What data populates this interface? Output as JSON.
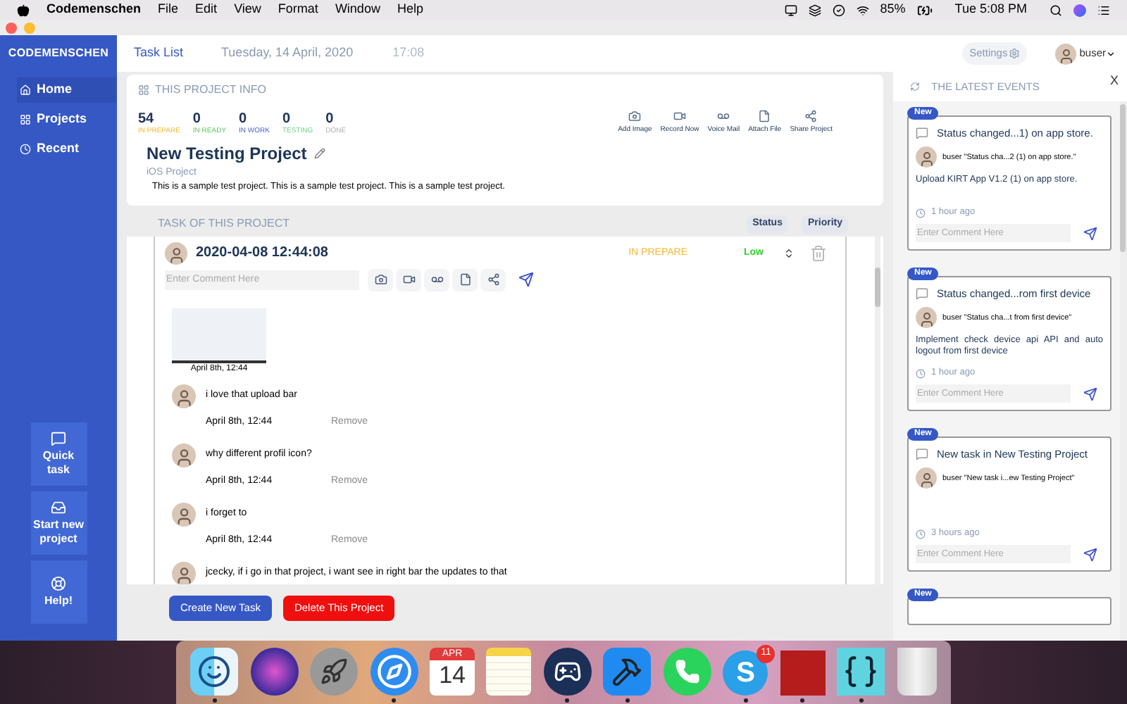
{
  "menubar": {
    "app": "Codemenschen",
    "menus": [
      "File",
      "Edit",
      "View",
      "Format",
      "Window",
      "Help"
    ],
    "battery": "85%",
    "clock": "Tue 5:08 PM"
  },
  "sidebar": {
    "brand": "CODEMENSCHEN",
    "items": [
      {
        "label": "Home",
        "selected": true
      },
      {
        "label": "Projects",
        "selected": false
      },
      {
        "label": "Recent",
        "selected": false
      }
    ],
    "actions": [
      "Quick task",
      "Start new project",
      "Help!"
    ]
  },
  "header": {
    "title": "Task List",
    "date": "Tuesday, 14 April, 2020",
    "time": "17:08",
    "settings": "Settings",
    "user": "buser"
  },
  "project_info": {
    "heading": "THIS PROJECT INFO",
    "stats": [
      {
        "value": "54",
        "label": "IN PREPARE",
        "color": "#f5b82e"
      },
      {
        "value": "0",
        "label": "IN READY",
        "color": "#5cc55c"
      },
      {
        "value": "0",
        "label": "IN WORK",
        "color": "#4a63c9"
      },
      {
        "value": "0",
        "label": "TESTING",
        "color": "#6fcf8a"
      },
      {
        "value": "0",
        "label": "DONE",
        "color": "#b0b0b0"
      }
    ],
    "actions": [
      "Add Image",
      "Record Now",
      "Voice Mail",
      "Attach File",
      "Share Project"
    ],
    "name": "New Testing Project",
    "type": "iOS Project",
    "description": "This is a sample test project. This is a sample test project. This is a sample test project."
  },
  "tasks": {
    "heading": "TASK OF THIS PROJECT",
    "columns": [
      "Status",
      "Priority"
    ],
    "task": {
      "timestamp": "2020-04-08 12:44:08",
      "status": "IN PREPARE",
      "priority": "Low",
      "comment_placeholder": "Enter Comment Here",
      "attachment_caption": "April 8th, 12:44",
      "comments": [
        {
          "text": "i love that upload bar",
          "time": "April 8th, 12:44",
          "action": "Remove"
        },
        {
          "text": "why different profil icon?",
          "time": "April 8th, 12:44",
          "action": "Remove"
        },
        {
          "text": "i forget to",
          "time": "April 8th, 12:44",
          "action": "Remove"
        },
        {
          "text": "jcecky, if i go in that project, i want see in right bar the updates to that"
        }
      ]
    }
  },
  "buttons": [
    {
      "label": "Create New Task",
      "kind": "primary"
    },
    {
      "label": "Delete This Project",
      "kind": "danger"
    }
  ],
  "events": {
    "heading": "THE LATEST EVENTS",
    "close": "X",
    "items": [
      {
        "badge": "New",
        "title": "Status changed...1) on app store.",
        "summary": "buser \"Status cha...2 (1) on app store.\"",
        "detail": "Upload KIRT App V1.2 (1) on app store.",
        "time": "1 hour ago",
        "placeholder": "Enter Comment Here"
      },
      {
        "badge": "New",
        "title": "Status changed...rom first device",
        "summary": "buser \"Status cha...t from first device\"",
        "detail": "Implement check device api API and auto logout from first device",
        "time": "1 hour ago",
        "placeholder": "Enter Comment Here"
      },
      {
        "badge": "New",
        "title": "New task in New Testing Project",
        "summary": "buser \"New task i...ew Testing Project\"",
        "time": "3 hours ago",
        "placeholder": "Enter Comment Here"
      },
      {
        "badge": "New"
      }
    ]
  },
  "dock": [
    {
      "kind": "finder",
      "running": true
    },
    {
      "kind": "orb",
      "running": false
    },
    {
      "kind": "rocket",
      "running": false
    },
    {
      "kind": "compass",
      "running": true
    },
    {
      "kind": "calendar",
      "month": "APR",
      "day": "14",
      "running": false
    },
    {
      "kind": "notepad",
      "running": false
    },
    {
      "kind": "steam",
      "running": true
    },
    {
      "kind": "hammer",
      "running": true
    },
    {
      "kind": "phone",
      "running": false
    },
    {
      "kind": "letter",
      "letter": "S",
      "badge": "11",
      "running": true
    },
    {
      "kind": "tile",
      "running": true
    },
    {
      "kind": "braces",
      "running": true
    },
    {
      "kind": "trash",
      "running": false
    }
  ]
}
